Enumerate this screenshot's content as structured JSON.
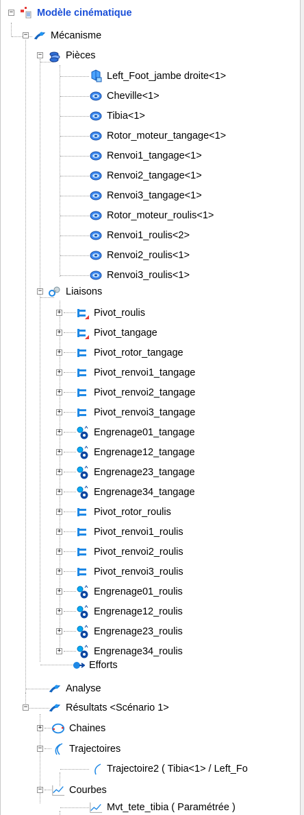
{
  "tree": {
    "root": {
      "label": "Modèle cinématique",
      "icon": "model-icon"
    },
    "mecanisme": {
      "label": "Mécanisme",
      "icon": "mechanism-icon"
    },
    "pieces": {
      "label": "Pièces",
      "icon": "parts-icon",
      "items": [
        {
          "label": "Left_Foot_jambe droite<1>",
          "icon": "fixed-part-icon"
        },
        {
          "label": "Cheville<1>",
          "icon": "part-icon"
        },
        {
          "label": "Tibia<1>",
          "icon": "part-icon"
        },
        {
          "label": "Rotor_moteur_tangage<1>",
          "icon": "part-icon"
        },
        {
          "label": "Renvoi1_tangage<1>",
          "icon": "part-icon"
        },
        {
          "label": "Renvoi2_tangage<1>",
          "icon": "part-icon"
        },
        {
          "label": "Renvoi3_tangage<1>",
          "icon": "part-icon"
        },
        {
          "label": "Rotor_moteur_roulis<1>",
          "icon": "part-icon"
        },
        {
          "label": "Renvoi1_roulis<2>",
          "icon": "part-icon"
        },
        {
          "label": "Renvoi2_roulis<1>",
          "icon": "part-icon"
        },
        {
          "label": "Renvoi3_roulis<1>",
          "icon": "part-icon"
        }
      ]
    },
    "liaisons": {
      "label": "Liaisons",
      "icon": "joints-icon",
      "items": [
        {
          "label": "Pivot_roulis",
          "icon": "pivot-driven-icon"
        },
        {
          "label": "Pivot_tangage",
          "icon": "pivot-driven-icon"
        },
        {
          "label": "Pivot_rotor_tangage",
          "icon": "pivot-icon"
        },
        {
          "label": "Pivot_renvoi1_tangage",
          "icon": "pivot-icon"
        },
        {
          "label": "Pivot_renvoi2_tangage",
          "icon": "pivot-icon"
        },
        {
          "label": "Pivot_renvoi3_tangage",
          "icon": "pivot-icon"
        },
        {
          "label": "Engrenage01_tangage",
          "icon": "gear-joint-icon"
        },
        {
          "label": "Engrenage12_tangage",
          "icon": "gear-joint-icon"
        },
        {
          "label": "Engrenage23_tangage",
          "icon": "gear-joint-icon"
        },
        {
          "label": "Engrenage34_tangage",
          "icon": "gear-joint-icon"
        },
        {
          "label": "Pivot_rotor_roulis",
          "icon": "pivot-icon"
        },
        {
          "label": "Pivot_renvoi1_roulis",
          "icon": "pivot-icon"
        },
        {
          "label": "Pivot_renvoi2_roulis",
          "icon": "pivot-icon"
        },
        {
          "label": "Pivot_renvoi3_roulis",
          "icon": "pivot-icon"
        },
        {
          "label": "Engrenage01_roulis",
          "icon": "gear-joint-icon"
        },
        {
          "label": "Engrenage12_roulis",
          "icon": "gear-joint-icon"
        },
        {
          "label": "Engrenage23_roulis",
          "icon": "gear-joint-icon"
        },
        {
          "label": "Engrenage34_roulis",
          "icon": "gear-joint-icon"
        }
      ]
    },
    "efforts": {
      "label": "Efforts",
      "icon": "efforts-icon"
    },
    "analyse": {
      "label": "Analyse",
      "icon": "analysis-icon"
    },
    "resultats": {
      "label": "Résultats <Scénario 1>",
      "icon": "results-icon"
    },
    "chaines": {
      "label": "Chaines",
      "icon": "chains-icon"
    },
    "trajectoires": {
      "label": "Trajectoires",
      "icon": "trajectories-icon",
      "items": [
        {
          "label": "Trajectoire2 ( Tibia<1> / Left_Fo",
          "icon": "trajectory-icon"
        }
      ]
    },
    "courbes": {
      "label": "Courbes",
      "icon": "curves-icon",
      "items": [
        {
          "label": "Mvt_tete_tibia ( Paramétrée )",
          "icon": "curve-icon"
        }
      ]
    }
  },
  "colors": {
    "root_text": "#1a4fd8",
    "pivot_blue": "#1e88e5",
    "gear_blue": "#1565c0",
    "mechanism_blue": "#1565c0",
    "red_accent": "#e53935",
    "tree_lines": "#a0a0a0"
  }
}
